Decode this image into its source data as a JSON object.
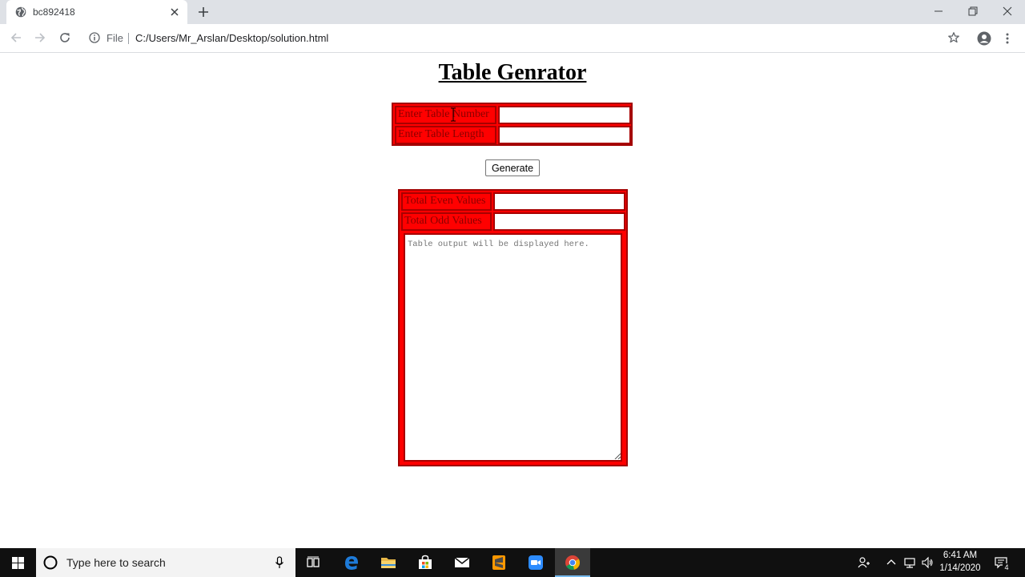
{
  "browser": {
    "tab": {
      "title": "bc892418"
    },
    "address_bar": {
      "scheme_label": "File",
      "url": "C:/Users/Mr_Arslan/Desktop/solution.html"
    }
  },
  "page": {
    "heading": "Table Genrator",
    "form": {
      "table_number_label": "Enter Table Number",
      "table_number_value": "",
      "table_length_label": "Enter Table Length",
      "table_length_value": ""
    },
    "generate_label": "Generate",
    "results": {
      "even_label": "Total Even Values",
      "even_value": "",
      "odd_label": "Total Odd Values",
      "odd_value": "",
      "output_placeholder": "Table output will be displayed here."
    }
  },
  "taskbar": {
    "search_placeholder": "Type here to search",
    "apps": [
      "task-view",
      "edge",
      "file-explorer",
      "store",
      "mail",
      "sublime-text",
      "zoom",
      "chrome"
    ],
    "clock": {
      "time": "6:41 AM",
      "date": "1/14/2020"
    },
    "notification_count": "4"
  },
  "colors": {
    "form_red": "#ff0000",
    "form_border": "#a80000",
    "chrome_tabstrip": "#dee1e6",
    "taskbar": "#101010"
  }
}
